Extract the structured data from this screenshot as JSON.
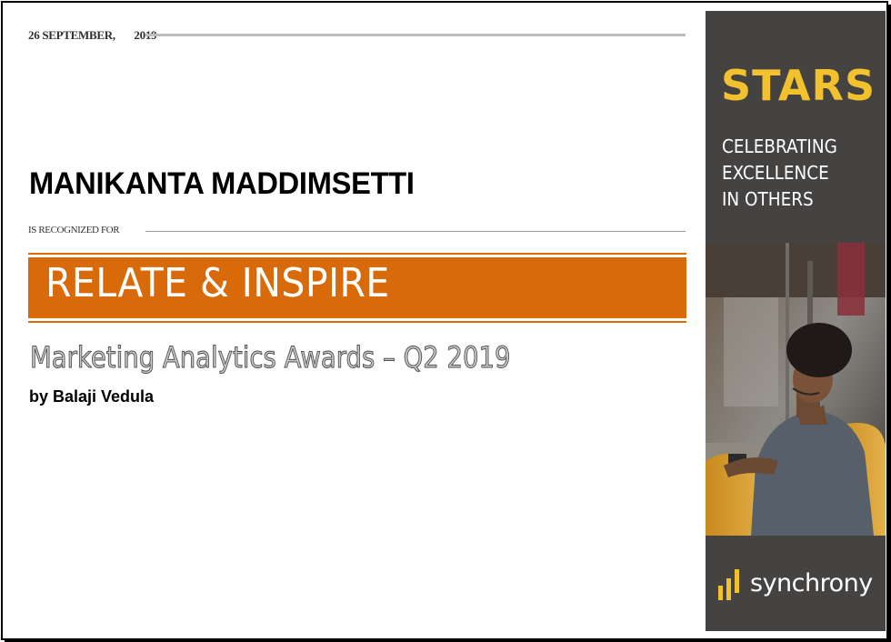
{
  "certificate": {
    "date": "26 SEPTEMBER,       2019",
    "recipient_name": "MANIKANTA MADDIMSETTI",
    "recognized_label": "IS RECOGNIZED FOR",
    "category": "RELATE & INSPIRE",
    "award": "Marketing Analytics Awards – Q2 2019",
    "presenter": "by Balaji Vedula"
  },
  "sidebar": {
    "program": "STARS",
    "tagline_line1": "CELEBRATING",
    "tagline_line2": "EXCELLENCE",
    "tagline_line3": "IN OTHERS",
    "brand": "synchrony"
  },
  "colors": {
    "accent_orange": "#d86a0a",
    "stars_yellow": "#f2c12e",
    "sidebar_gray": "#454242"
  }
}
